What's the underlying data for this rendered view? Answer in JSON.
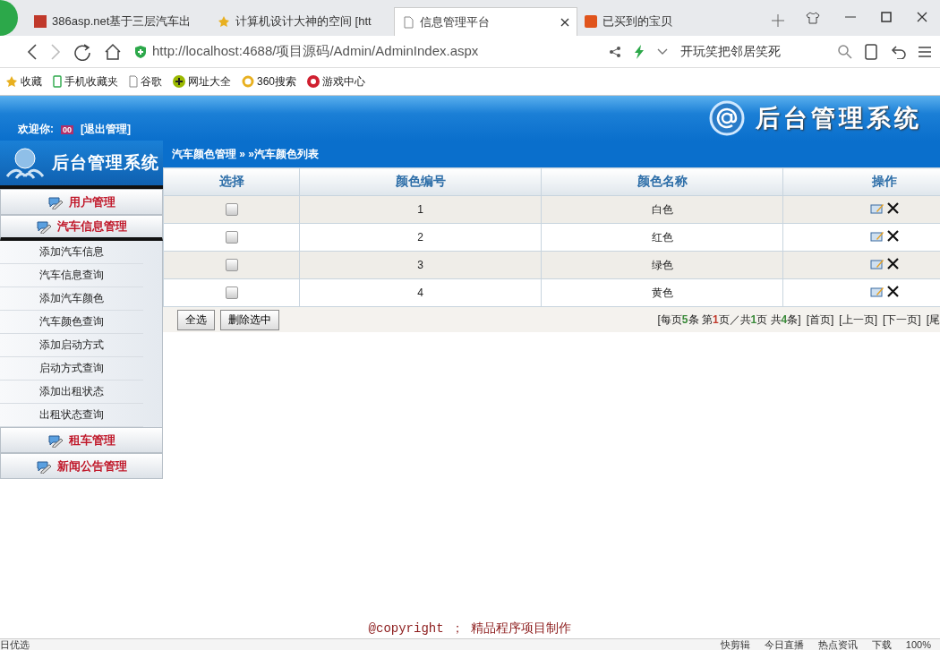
{
  "browser": {
    "tabs": [
      {
        "title": "386asp.net基于三层汽车出",
        "selected": false
      },
      {
        "title": "计算机设计大神的空间 [htt",
        "selected": false
      },
      {
        "title": "信息管理平台",
        "selected": true
      },
      {
        "title": "已买到的宝贝",
        "selected": false
      }
    ],
    "url": "http://localhost:4688/项目源码/Admin/AdminIndex.aspx",
    "search_text": "开玩笑把邻居笑死",
    "bookmarks": [
      "收藏",
      "手机收藏夹",
      "谷歌",
      "网址大全",
      "360搜索",
      "游戏中心"
    ]
  },
  "header": {
    "title": "后台管理系统",
    "welcome_label": "欢迎你:",
    "user": "00",
    "logout": "[退出管理]"
  },
  "sidebar": {
    "title": "后台管理系统",
    "groups": [
      {
        "label": "用户管理",
        "expanded": false
      },
      {
        "label": "汽车信息管理",
        "expanded": true,
        "children": [
          "添加汽车信息",
          "汽车信息查询",
          "添加汽车颜色",
          "汽车颜色查询",
          "添加启动方式",
          "启动方式查询",
          "添加出租状态",
          "出租状态查询"
        ]
      },
      {
        "label": "租车管理",
        "expanded": false
      },
      {
        "label": "新闻公告管理",
        "expanded": false
      }
    ]
  },
  "breadcrumb": "汽车颜色管理 » »汽车颜色列表",
  "table": {
    "columns": [
      "选择",
      "颜色编号",
      "颜色名称",
      "操作"
    ],
    "rows": [
      {
        "checked": false,
        "id": "1",
        "name": "白色"
      },
      {
        "checked": false,
        "id": "2",
        "name": "红色"
      },
      {
        "checked": false,
        "id": "3",
        "name": "绿色"
      },
      {
        "checked": false,
        "id": "4",
        "name": "黄色"
      }
    ]
  },
  "buttons": [
    "全选",
    "删除选中"
  ],
  "pager": {
    "info": [
      {
        "text": "[每页"
      },
      {
        "text": "5",
        "color": "#3a8a3a"
      },
      {
        "text": "条 第"
      },
      {
        "text": "1",
        "color": "#c0392b"
      },
      {
        "text": "页／共"
      },
      {
        "text": "1",
        "color": "#3a8a3a"
      },
      {
        "text": "页 共"
      },
      {
        "text": "4",
        "color": "#3a8a3a"
      },
      {
        "text": "条]"
      }
    ],
    "links": [
      "[首页]",
      "[上一页]",
      "[下一页]",
      "[尾"
    ]
  },
  "footer": "@copyright ； 精品程序项目制作",
  "status_bar": {
    "left": "日优选",
    "items": [
      "快剪辑",
      "今日直播",
      "热点资讯",
      "下载",
      "100%"
    ]
  }
}
